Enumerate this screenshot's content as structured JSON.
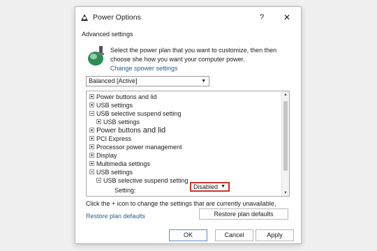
{
  "window": {
    "title": "Power Options",
    "help_glyph": "?",
    "close_glyph": "✕",
    "tab": "Advanced settings"
  },
  "intro": {
    "line1": "Select the power plan that you want to customize, then then",
    "line2": "choose she how you want your computer power.",
    "link": "Change spower settings"
  },
  "plan_select": {
    "value": "Balanced [Active]",
    "arrow": "▼"
  },
  "tree": {
    "items": [
      {
        "label": "Power buttons and lid",
        "expander": "plus"
      },
      {
        "label": "USB settings",
        "expander": "plus"
      },
      {
        "label": "USB selective suspend setting",
        "expander": "minus"
      },
      {
        "label": "USB settings",
        "expander": "plus"
      },
      {
        "label": "Power buttons",
        "label2": "and lid",
        "expander": "plus"
      },
      {
        "label": "PCI Express",
        "expander": "plus"
      },
      {
        "label": "Processor power management",
        "expander": "plus"
      },
      {
        "label": "Display",
        "expander": "plus"
      },
      {
        "label": "Multimedia settings",
        "expander": "plus"
      },
      {
        "label": "USB settings",
        "expander": "minus"
      },
      {
        "label": "USB selective suspend setting",
        "expander": "minus"
      }
    ],
    "setting_label": "Setting:",
    "setting_value": "Disabled",
    "setting_arrow": "▼",
    "scroll_up": "▲",
    "scroll_down": "▼"
  },
  "footer": {
    "info": "Click the + icon to change the settings that are currently unavailable,",
    "restore_link": "Restore plan defaults",
    "restore_button": "Restore plan defaults"
  },
  "buttons": {
    "ok": "OK",
    "cancel": "Cancel",
    "apply": "Apply"
  },
  "colors": {
    "annotation": "#c0392b",
    "link": "#1f5c97",
    "default_button_border": "#5b8ed3"
  }
}
